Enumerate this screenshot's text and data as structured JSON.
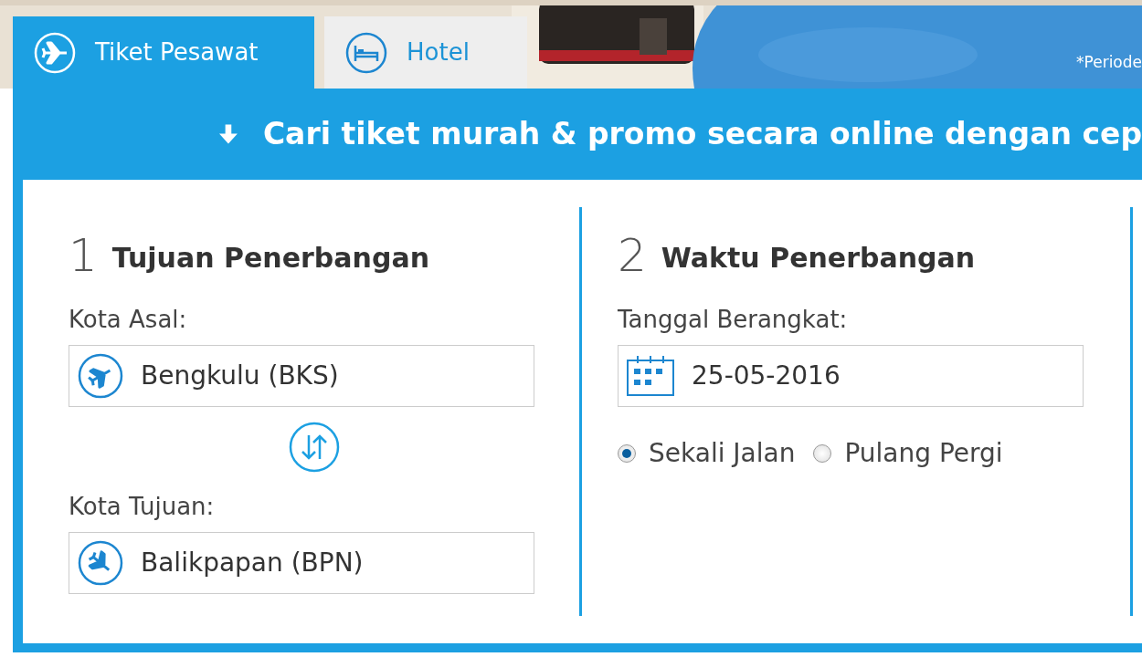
{
  "tabs": [
    {
      "label": "Tiket Pesawat",
      "selected": true,
      "kind": "plane"
    },
    {
      "label": "Hotel",
      "selected": false,
      "kind": "hotel"
    }
  ],
  "promo_note": "*Periode",
  "headline": "Cari tiket murah & promo secara online dengan cep",
  "sections": [
    {
      "number": "1",
      "title": "Tujuan Penerbangan",
      "items": [
        {
          "kind": "field",
          "label": "Kota Asal:",
          "value": "Bengkulu (BKS)"
        },
        {
          "kind": "swap"
        },
        {
          "kind": "field",
          "label": "Kota Tujuan:",
          "value": "Balikpapan (BPN)"
        }
      ]
    },
    {
      "number": "2",
      "title": "Waktu Penerbangan",
      "items": [
        {
          "kind": "date",
          "label": "Tanggal Berangkat:",
          "value": "25-05-2016"
        },
        {
          "kind": "radios",
          "options": [
            {
              "label": "Sekali Jalan",
              "selected": true
            },
            {
              "label": "Pulang Pergi",
              "selected": false
            }
          ]
        }
      ]
    }
  ]
}
